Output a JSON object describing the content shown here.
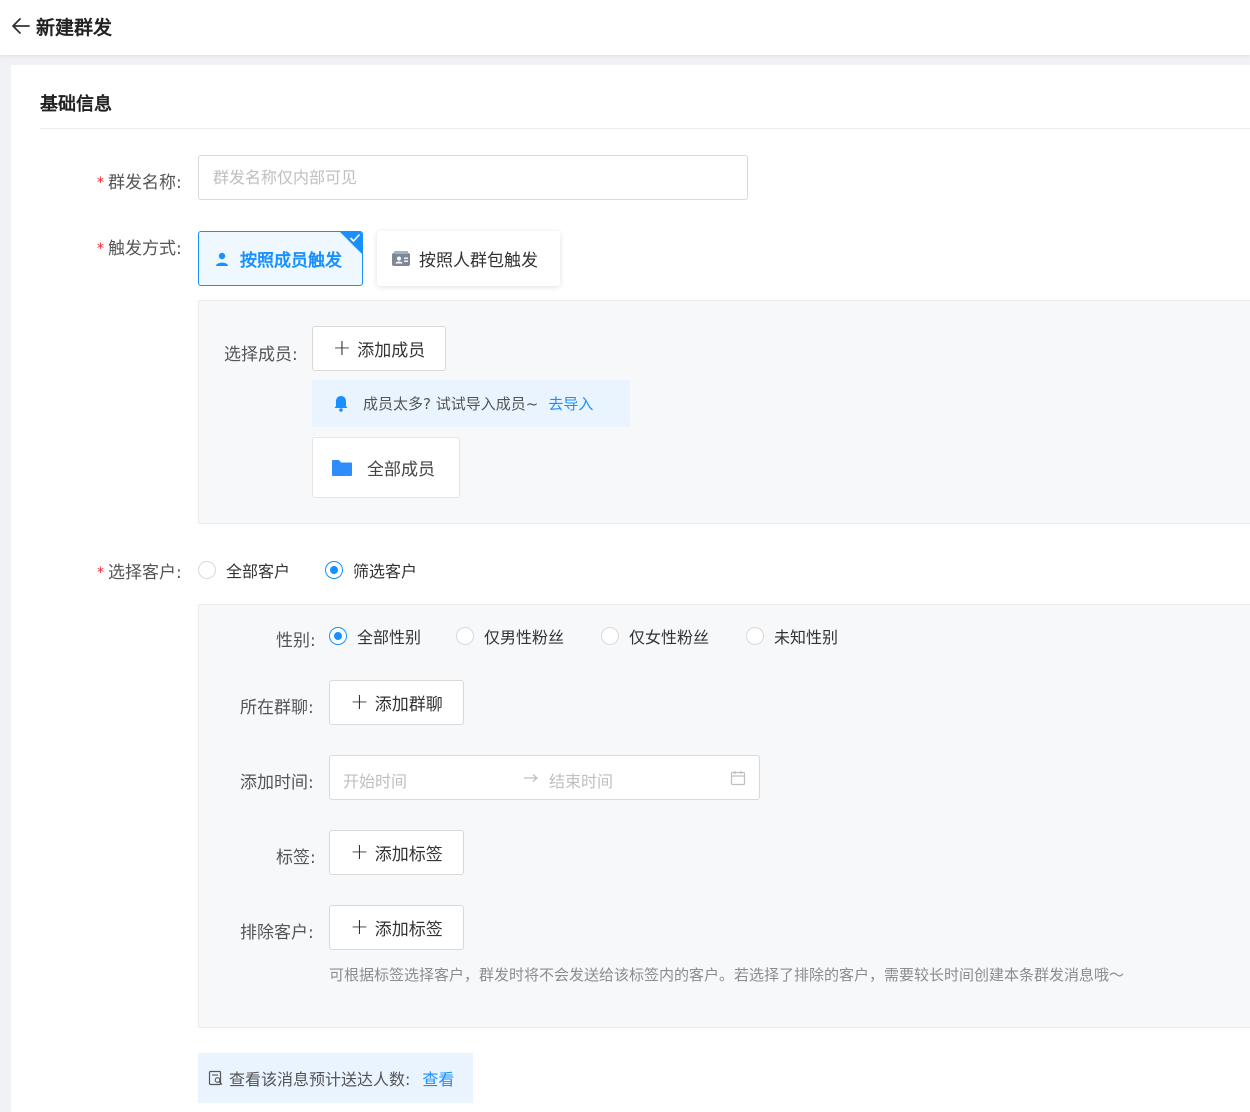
{
  "header": {
    "title": "新建群发",
    "back_icon": "arrow-left-icon"
  },
  "section": {
    "title": "基础信息"
  },
  "form": {
    "name": {
      "label": "群发名称:",
      "placeholder": "群发名称仅内部可见",
      "value": ""
    },
    "trigger": {
      "label": "触发方式:",
      "options": [
        {
          "label": "按照成员触发",
          "icon": "user-icon",
          "selected": true
        },
        {
          "label": "按照人群包触发",
          "icon": "contact-card-icon",
          "selected": false
        }
      ]
    },
    "members": {
      "label": "选择成员:",
      "add_button": "添加成员",
      "tip_text": "成员太多? 试试导入成员~",
      "tip_link": "去导入",
      "chip_label": "全部成员",
      "chip_icon": "folder-icon"
    },
    "customers": {
      "label": "选择客户:",
      "options": [
        {
          "label": "全部客户",
          "checked": false
        },
        {
          "label": "筛选客户",
          "checked": true
        }
      ]
    },
    "filters": {
      "gender": {
        "label": "性别:",
        "options": [
          {
            "label": "全部性别",
            "checked": true
          },
          {
            "label": "仅男性粉丝",
            "checked": false
          },
          {
            "label": "仅女性粉丝",
            "checked": false
          },
          {
            "label": "未知性别",
            "checked": false
          }
        ]
      },
      "group_chat": {
        "label": "所在群聊:",
        "add_button": "添加群聊"
      },
      "add_time": {
        "label": "添加时间:",
        "start_placeholder": "开始时间",
        "end_placeholder": "结束时间"
      },
      "tags": {
        "label": "标签:",
        "add_button": "添加标签"
      },
      "exclude": {
        "label": "排除客户:",
        "add_button": "添加标签",
        "hint": "可根据标签选择客户，群发时将不会发送给该标签内的客户。若选择了排除的客户，需要较长时间创建本条群发消息哦～"
      }
    },
    "estimate": {
      "text": "查看该消息预计送达人数:",
      "link": "查看"
    }
  },
  "colors": {
    "primary": "#1890ff",
    "required": "#f5222d",
    "panel_bg": "#f7f8fa",
    "tip_bg": "#eaf4ff"
  }
}
